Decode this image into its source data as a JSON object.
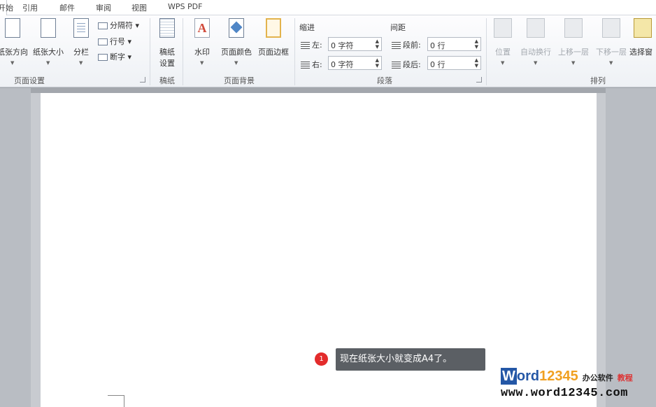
{
  "tabs": [
    "开始",
    "引用",
    "邮件",
    "审阅",
    "视图",
    "WPS PDF"
  ],
  "page_setup": {
    "orientation": "纸张方向",
    "size": "纸张大小",
    "columns": "分栏",
    "breaks": "分隔符",
    "line_numbers": "行号",
    "hyphenation": "断字",
    "group": "页面设置"
  },
  "manuscript": {
    "label1": "稿纸",
    "label2": "设置",
    "group": "稿纸"
  },
  "page_background": {
    "watermark": "水印",
    "page_color": "页面颜色",
    "page_borders": "页面边框",
    "group": "页面背景"
  },
  "paragraph": {
    "indent_title": "缩进",
    "spacing_title": "间距",
    "left_label": "左:",
    "right_label": "右:",
    "before_label": "段前:",
    "after_label": "段后:",
    "left_value": "0 字符",
    "right_value": "0 字符",
    "before_value": "0 行",
    "after_value": "0 行",
    "group": "段落"
  },
  "arrange": {
    "position": "位置",
    "wrap": "自动换行",
    "forward": "上移一层",
    "backward": "下移一层",
    "select_pane": "选择窗",
    "group": "排列"
  },
  "tooltip": {
    "step": "1",
    "text": "现在纸张大小就变成A4了。"
  },
  "logo": {
    "w": "W",
    "rest": "ord",
    "nums": "12345",
    "cn1": "办公软件",
    "cn2": "教程",
    "url": "www.word12345.com"
  }
}
